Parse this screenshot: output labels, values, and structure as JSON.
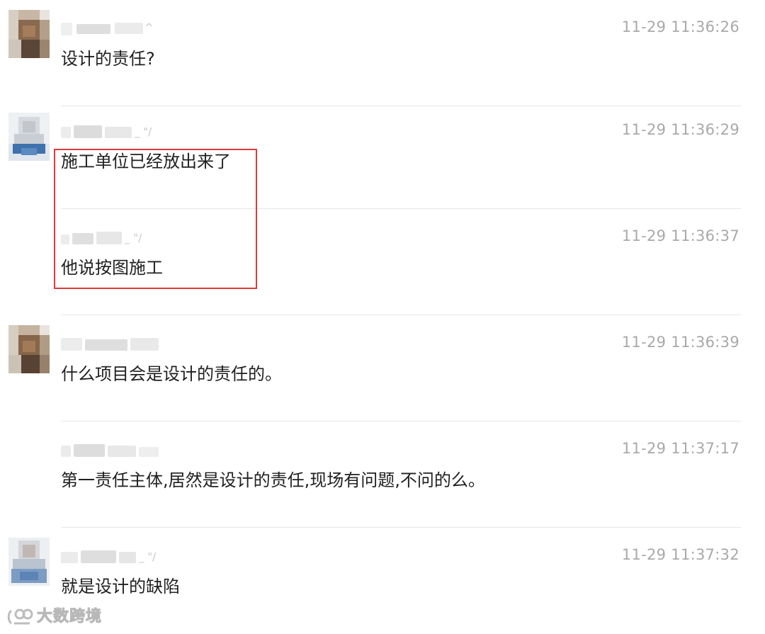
{
  "messages": [
    {
      "time": "11-29 11:36:26",
      "text": "设计的责任?",
      "sender_mark": "^",
      "avatar_style": "brown"
    },
    {
      "time": "11-29 11:36:29",
      "text": "施工单位已经放出来了",
      "sender_mark": "_ \"/",
      "avatar_style": "blue"
    },
    {
      "time": "11-29 11:36:37",
      "text": "他说按图施工",
      "sender_mark": "_ \"/",
      "avatar_style": "none"
    },
    {
      "time": "11-29 11:36:39",
      "text": "什么项目会是设计的责任的。",
      "sender_mark": "",
      "avatar_style": "brown"
    },
    {
      "time": "11-29 11:37:17",
      "text": "第一责任主体,居然是设计的责任,现场有问题,不问的么。",
      "sender_mark": "",
      "avatar_style": "none"
    },
    {
      "time": "11-29 11:37:32",
      "text": "就是设计的缺陷",
      "sender_mark": "_ \"/",
      "avatar_style": "blue"
    }
  ],
  "watermark": {
    "text": "大数跨境",
    "icon": "logo-mark"
  },
  "colors": {
    "highlight_border": "#e0393c",
    "timestamp": "#a9a9a9",
    "message_text": "#1f1f1f",
    "divider": "#e6e6e6"
  }
}
